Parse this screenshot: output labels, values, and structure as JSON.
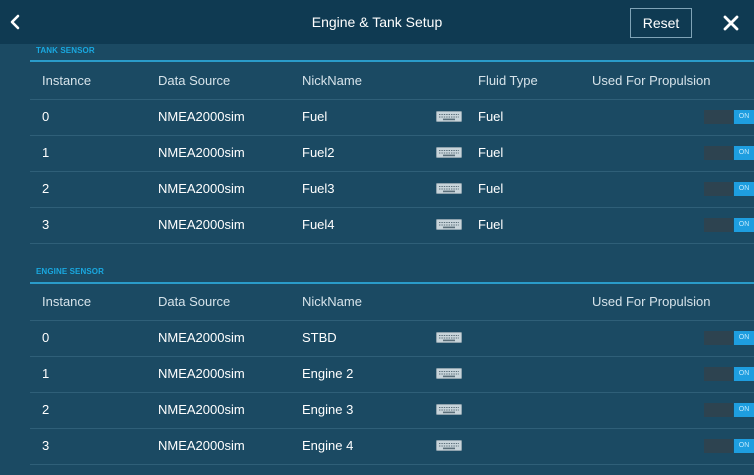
{
  "header": {
    "title": "Engine & Tank Setup",
    "reset_label": "Reset"
  },
  "tank_sensor": {
    "section_label": "TANK SENSOR",
    "columns": {
      "instance": "Instance",
      "data_source": "Data Source",
      "nickname": "NickName",
      "fluid_type": "Fluid Type",
      "propulsion": "Used For Propulsion"
    },
    "rows": [
      {
        "instance": "0",
        "data_source": "NMEA2000sim",
        "nickname": "Fuel",
        "fluid_type": "Fuel",
        "toggle": "ON"
      },
      {
        "instance": "1",
        "data_source": "NMEA2000sim",
        "nickname": "Fuel2",
        "fluid_type": "Fuel",
        "toggle": "ON"
      },
      {
        "instance": "2",
        "data_source": "NMEA2000sim",
        "nickname": "Fuel3",
        "fluid_type": "Fuel",
        "toggle": "ON"
      },
      {
        "instance": "3",
        "data_source": "NMEA2000sim",
        "nickname": "Fuel4",
        "fluid_type": "Fuel",
        "toggle": "ON"
      }
    ]
  },
  "engine_sensor": {
    "section_label": "ENGINE SENSOR",
    "columns": {
      "instance": "Instance",
      "data_source": "Data Source",
      "nickname": "NickName",
      "propulsion": "Used For Propulsion"
    },
    "rows": [
      {
        "instance": "0",
        "data_source": "NMEA2000sim",
        "nickname": "STBD",
        "toggle": "ON"
      },
      {
        "instance": "1",
        "data_source": "NMEA2000sim",
        "nickname": "Engine 2",
        "toggle": "ON"
      },
      {
        "instance": "2",
        "data_source": "NMEA2000sim",
        "nickname": "Engine 3",
        "toggle": "ON"
      },
      {
        "instance": "3",
        "data_source": "NMEA2000sim",
        "nickname": "Engine 4",
        "toggle": "ON"
      }
    ]
  },
  "icons": {
    "back": "chevron-left-icon",
    "close": "close-icon",
    "keyboard": "keyboard-icon"
  },
  "colors": {
    "background": "#1b4a63",
    "titlebar": "#0f3a52",
    "accent": "#1e9ee0",
    "section_label": "#19a8e0"
  }
}
